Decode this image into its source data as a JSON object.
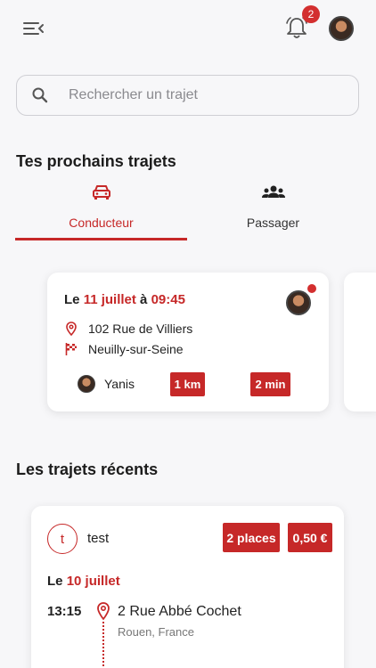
{
  "topbar": {
    "menu_icon": "menu-collapse-icon",
    "notification_count": "2",
    "bell_icon": "bell-icon"
  },
  "search": {
    "placeholder": "Rechercher un trajet",
    "icon": "search-icon"
  },
  "upcoming": {
    "title": "Tes prochains trajets",
    "tabs": [
      {
        "label": "Conducteur",
        "icon": "car-icon",
        "active": true
      },
      {
        "label": "Passager",
        "icon": "people-icon",
        "active": false
      }
    ],
    "card": {
      "date_prefix": "Le ",
      "date": "11 juillet",
      "date_joiner": " à ",
      "time": "09:45",
      "origin": "102 Rue de Villiers",
      "destination": "Neuilly-sur-Seine",
      "driver": "Yanis",
      "distance": "1 km",
      "duration": "2 min"
    }
  },
  "recent": {
    "title": "Les trajets récents",
    "card": {
      "initial": "t",
      "name": "test",
      "places": "2 places",
      "price": "0,50 €",
      "date_prefix": "Le ",
      "date": "10 juillet",
      "time": "13:15",
      "address": "2 Rue Abbé Cochet",
      "city": "Rouen, France"
    }
  },
  "colors": {
    "accent": "#c62828",
    "background": "#f7f7f9"
  }
}
